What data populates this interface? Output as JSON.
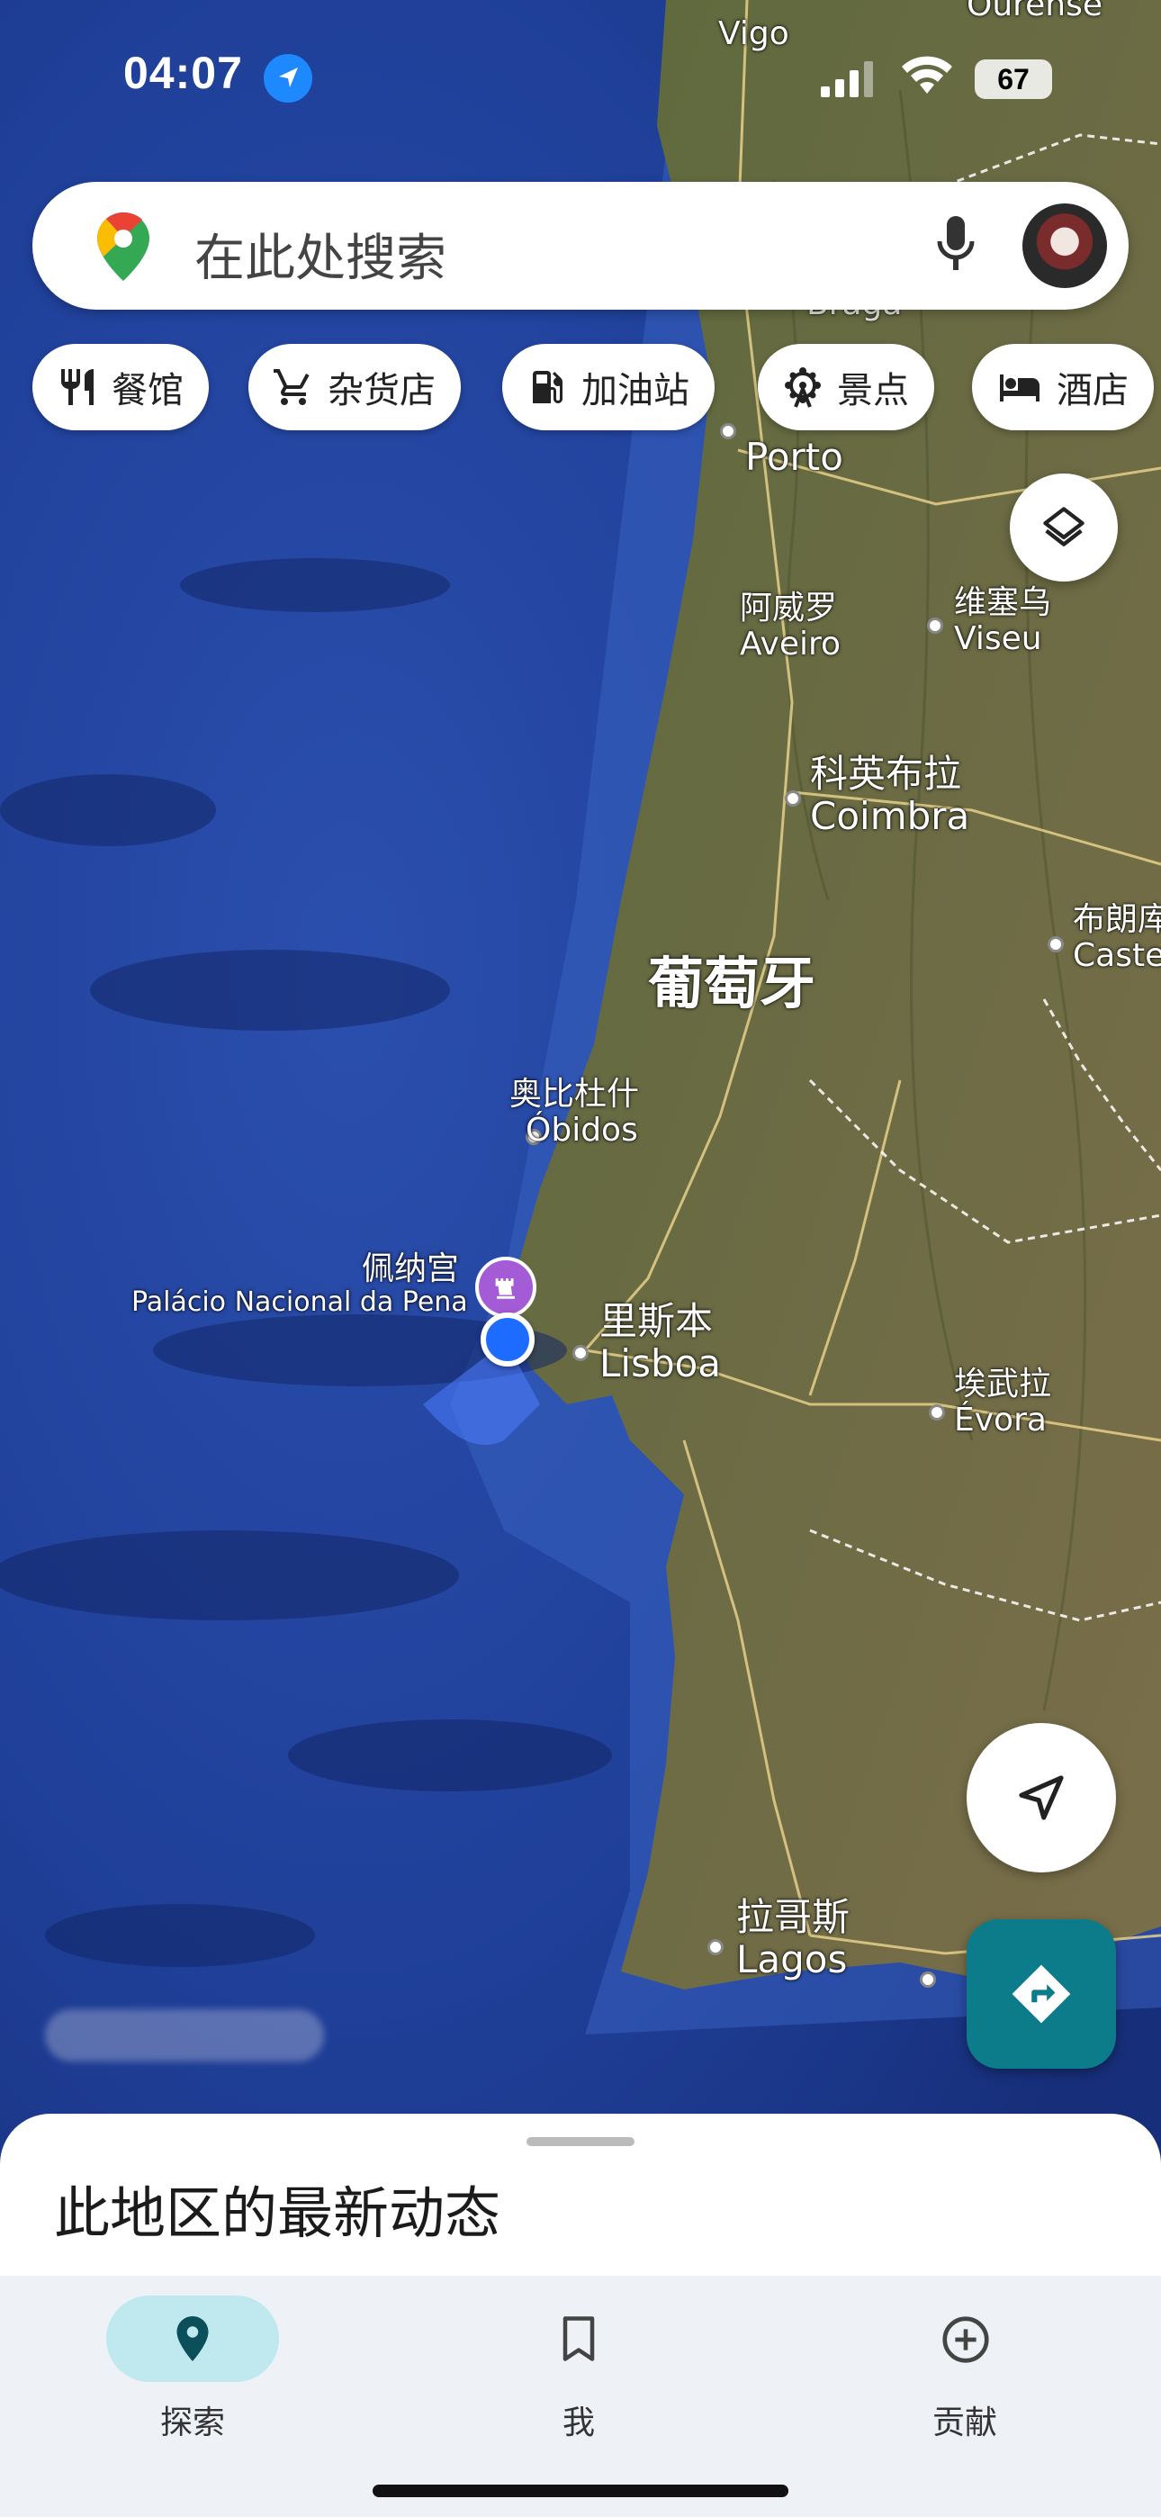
{
  "status_bar": {
    "time": "04:07",
    "battery": "67"
  },
  "search": {
    "placeholder": "在此处搜索"
  },
  "chips": [
    {
      "label": "餐馆",
      "icon": "restaurant-icon"
    },
    {
      "label": "杂货店",
      "icon": "cart-icon"
    },
    {
      "label": "加油站",
      "icon": "gas-station-icon"
    },
    {
      "label": "景点",
      "icon": "ferris-wheel-icon"
    },
    {
      "label": "酒店",
      "icon": "bed-icon"
    }
  ],
  "map": {
    "country": "葡萄牙",
    "places": {
      "vigo": "Vigo",
      "ourense": "Ourense",
      "braga": "Braga",
      "porto": "Porto",
      "aveiro_zh": "阿威罗",
      "aveiro_en": "Aveiro",
      "viseu_zh": "维塞乌",
      "viseu_en": "Viseu",
      "coimbra_zh": "科英布拉",
      "coimbra_en": "Coimbra",
      "castelo_zh": "布朗库",
      "castelo_en": "Caste",
      "obidos_zh": "奥比杜什",
      "obidos_en": "Óbidos",
      "pena_zh": "佩纳宫",
      "pena_en": "Palácio Nacional da Pena",
      "lisboa_zh": "里斯本",
      "lisboa_en": "Lisboa",
      "evora_zh": "埃武拉",
      "evora_en": "Évora",
      "lagos_zh": "拉哥斯",
      "lagos_en": "Lagos"
    }
  },
  "sheet": {
    "title": "此地区的最新动态"
  },
  "nav": [
    {
      "label": "探索",
      "icon": "explore-pin-icon",
      "active": true
    },
    {
      "label": "我",
      "icon": "bookmark-icon",
      "active": false
    },
    {
      "label": "贡献",
      "icon": "add-circle-icon",
      "active": false
    }
  ],
  "colors": {
    "accent": "#0d7c8a",
    "nav_active": "#bfe9ef",
    "location": "#1e6bff"
  }
}
